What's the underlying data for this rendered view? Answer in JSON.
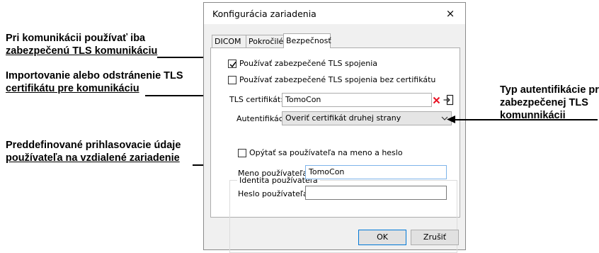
{
  "callouts": {
    "tls_only": [
      "Pri komunikácii používať iba",
      "zabezpečenú TLS komunikáciu"
    ],
    "cert_import": [
      "Importovanie alebo odstránenie TLS",
      "certifikátu pre komunikáciu"
    ],
    "auth_type": [
      "Typ autentifikácie pri",
      "zabezpečenej TLS",
      "komunnikácii"
    ],
    "credentials": [
      "Preddefinované prihlasovacie údaje",
      "používateľa na vzdialené zariadenie"
    ]
  },
  "dialog": {
    "title": "Konfigurácia zariadenia",
    "close": "×",
    "tabs": [
      "DICOM",
      "Pokročilé",
      "Bezpečnosť"
    ],
    "active_tab": "Bezpečnosť",
    "use_tls": {
      "label": "Používať zabezpečené TLS spojenia",
      "checked": true
    },
    "use_tls_no_cert": {
      "label": "Používať zabezpečené TLS spojenia bez certifikátu",
      "checked": false
    },
    "tls_cert": {
      "label": "TLS certifikát:",
      "value": "TomoCon",
      "remove_icon": "red-x-icon",
      "import_icon": "import-icon"
    },
    "authentication": {
      "label": "Autentifikácia:",
      "selected": "Overiť certifikát druhej strany"
    },
    "identity": {
      "legend": "Identita používateľa",
      "ask_user": {
        "label": "Opýtať sa používateľa na meno a heslo",
        "checked": false
      },
      "username": {
        "label": "Meno používateľa:",
        "value": "TomoCon"
      },
      "password": {
        "label": "Heslo používateľa:",
        "value": ""
      }
    },
    "buttons": {
      "ok": "OK",
      "cancel": "Zrušiť"
    }
  }
}
